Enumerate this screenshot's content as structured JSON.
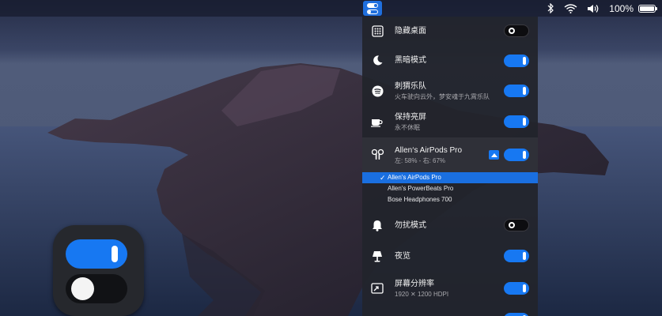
{
  "colors": {
    "accent": "#1778f2",
    "panel_bg": "#22242c",
    "selection": "#1a6fe0"
  },
  "menubar": {
    "app_icon": "toggle-switches-icon",
    "status_icons": [
      "bluetooth-icon",
      "wifi-icon",
      "volume-icon"
    ],
    "battery_percent": "100%",
    "battery_icon": "battery-full-icon"
  },
  "panel": {
    "items": [
      {
        "icon": "grid-icon",
        "title": "隐藏桌面",
        "subtitle": "",
        "toggle": "off"
      },
      {
        "icon": "moon-icon",
        "title": "黑暗模式",
        "subtitle": "",
        "toggle": "on"
      },
      {
        "icon": "spotify-icon",
        "title": "刺猬乐队",
        "subtitle": "火车驶向云外，梦安魂于九霄乐队",
        "toggle": "on"
      },
      {
        "icon": "coffee-cup-icon",
        "title": "保持亮屏",
        "subtitle": "永不休眠",
        "toggle": "on"
      },
      {
        "icon": "airpods-icon",
        "title": "Allen‘s AirPods Pro",
        "subtitle": "左: 58% - 右: 67%",
        "toggle": "on",
        "expanded": true
      },
      {
        "icon": "bell-icon",
        "title": "勿扰模式",
        "subtitle": "",
        "toggle": "off"
      },
      {
        "icon": "lamp-icon",
        "title": "夜览",
        "subtitle": "",
        "toggle": "on"
      },
      {
        "icon": "display-resize-icon",
        "title": "屏幕分辨率",
        "subtitle": "1920 ✕ 1200 HDPI",
        "toggle": "on"
      }
    ],
    "devices": [
      {
        "name": "Allen's AirPods Pro",
        "selected": true
      },
      {
        "name": "Allen's PowerBeats Pro",
        "selected": false
      },
      {
        "name": "Bose Headphones 700",
        "selected": false
      }
    ]
  },
  "app_icon": {
    "name": "toggle-app-icon"
  }
}
